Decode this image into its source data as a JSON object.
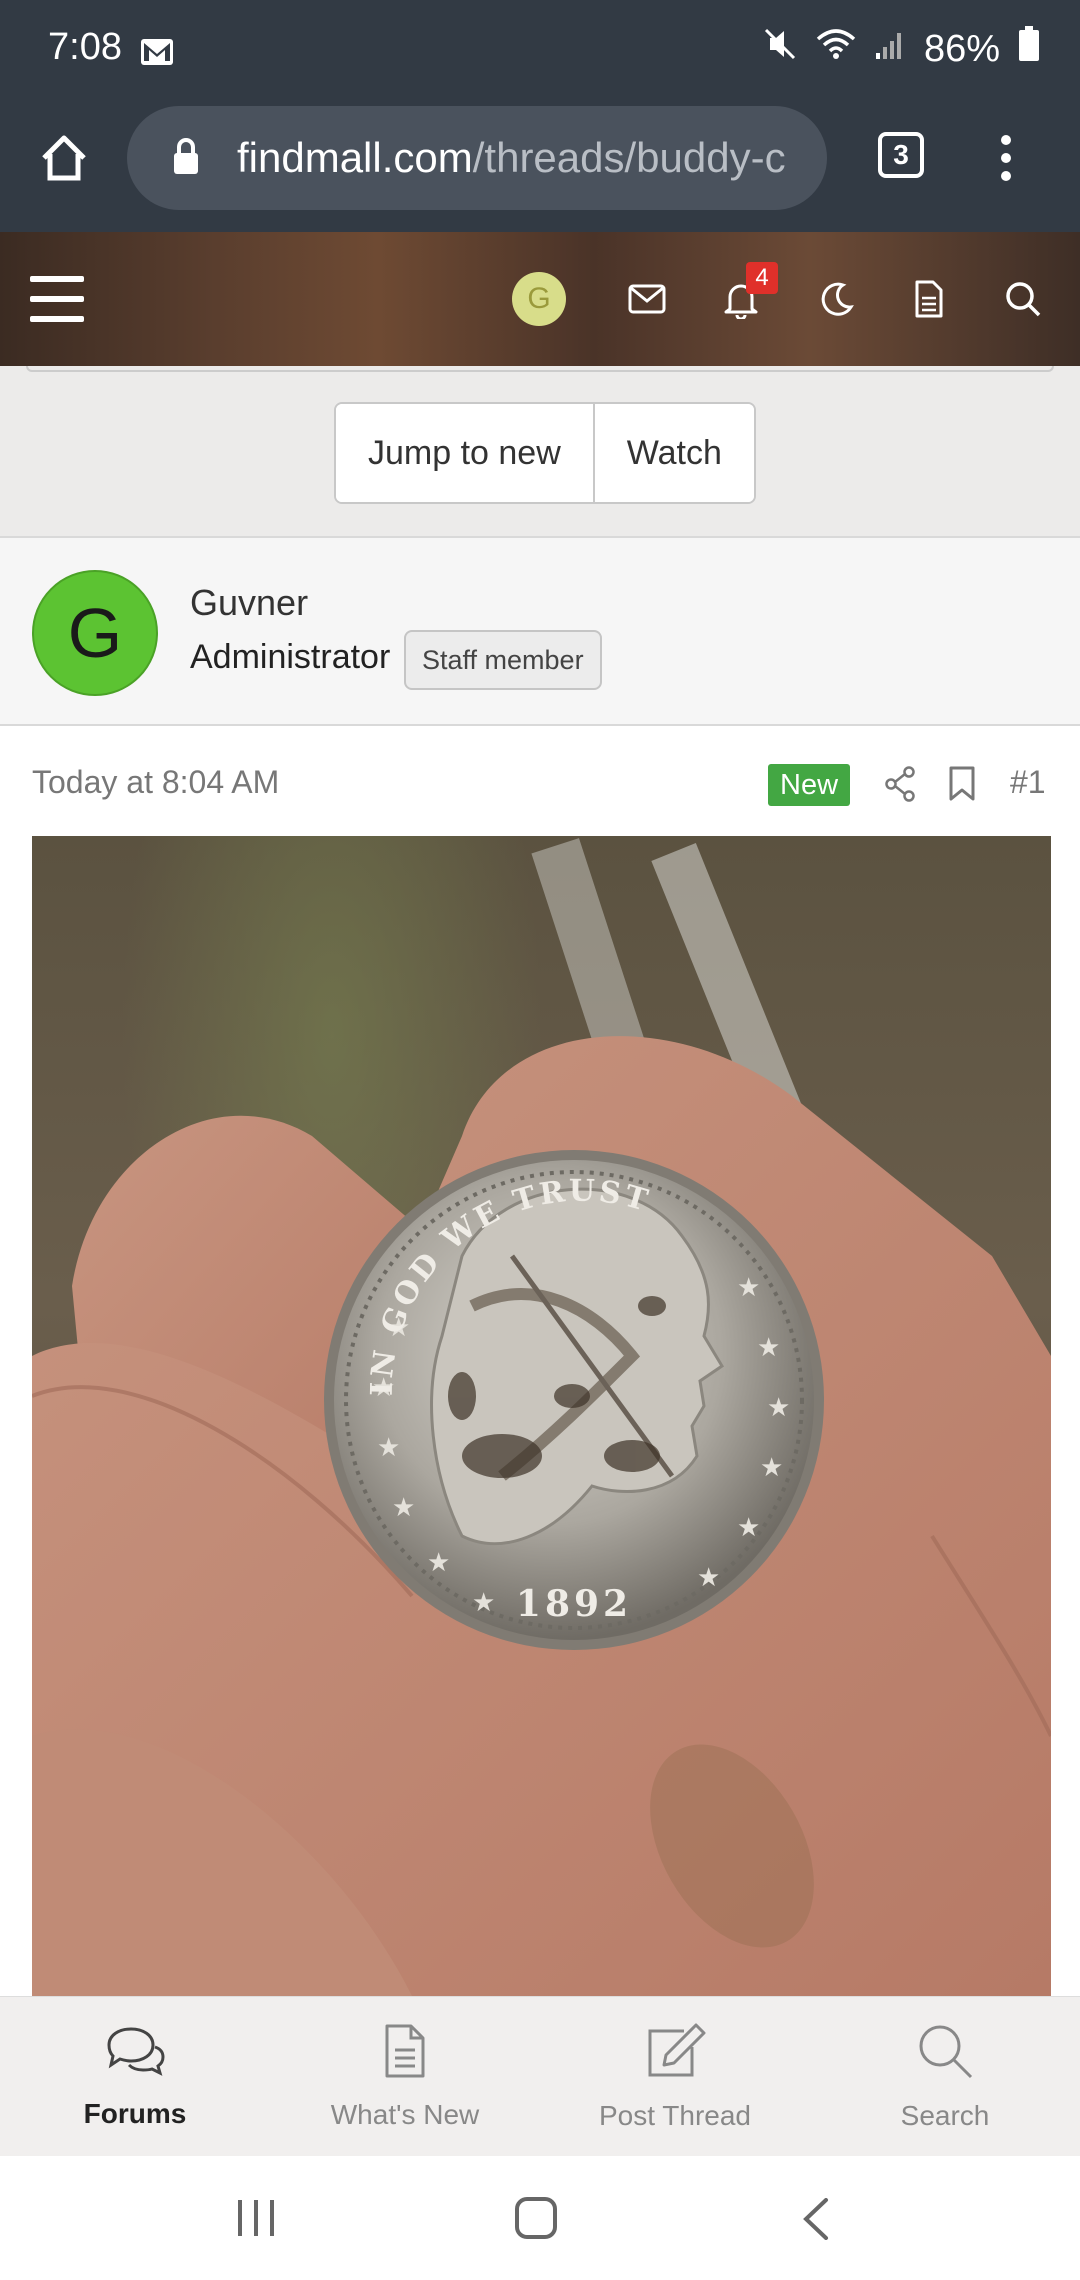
{
  "status": {
    "time": "7:08",
    "battery": "86%"
  },
  "browser": {
    "url_domain": "findmall.com",
    "url_path": "/threads/buddy-c",
    "tab_count": "3"
  },
  "forumbar": {
    "user_initial": "G",
    "alerts_count": "4"
  },
  "actions": {
    "jump_label": "Jump to new",
    "watch_label": "Watch"
  },
  "user": {
    "avatar_letter": "G",
    "name": "Guvner",
    "title": "Administrator",
    "badge": "Staff member"
  },
  "post": {
    "date": "Today at 8:04 AM",
    "new_badge": "New",
    "number": "#1",
    "coin_legend": "IN GOD WE TRUST",
    "coin_year": "1892"
  },
  "tabs": [
    {
      "label": "Forums"
    },
    {
      "label": "What's New"
    },
    {
      "label": "Post Thread"
    },
    {
      "label": "Search"
    }
  ],
  "colors": {
    "chrome_bg": "#323a44",
    "avatar_green": "#5cc332",
    "new_badge": "#43a743",
    "alert_red": "#e0302a"
  }
}
